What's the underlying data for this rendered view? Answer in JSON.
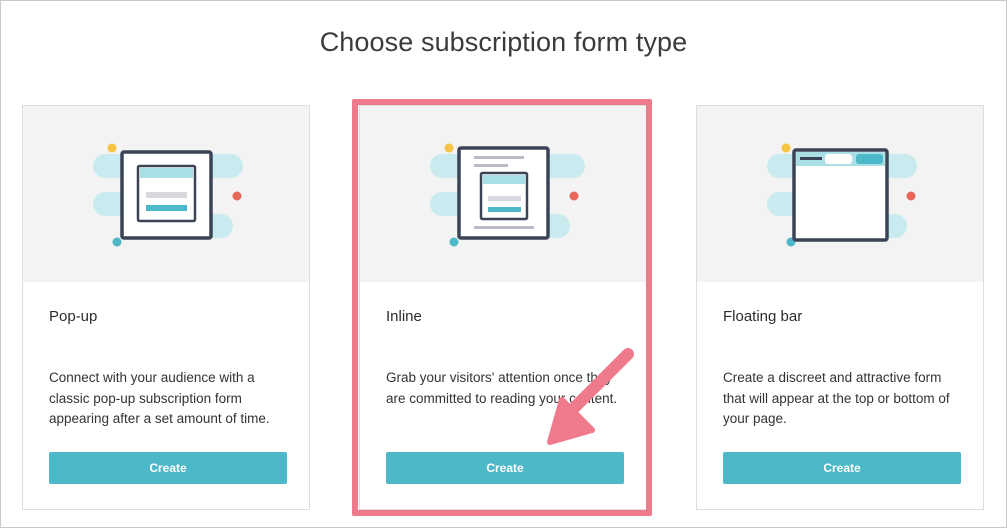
{
  "page": {
    "title": "Choose subscription form type"
  },
  "cards": [
    {
      "name": "Pop-up",
      "description": "Connect with your audience with a classic pop-up subscription form appearing after a set amount of time.",
      "button": "Create",
      "icon": "popup-illustration-icon"
    },
    {
      "name": "Inline",
      "description": "Grab your visitors' attention once they are committed to reading your content.",
      "button": "Create",
      "icon": "inline-illustration-icon"
    },
    {
      "name": "Floating bar",
      "description": "Create a discreet and attractive form that will appear at the top or bottom of your page.",
      "button": "Create",
      "icon": "floating-bar-illustration-icon"
    }
  ],
  "annotation": {
    "highlight_color": "#ee7a8c",
    "arrow_color": "#ee7a8c"
  },
  "colors": {
    "accent": "#4db8c8",
    "dark": "#3a4456",
    "yellow": "#f5c443",
    "red": "#e8685c",
    "teal_light": "#c9eaee"
  }
}
